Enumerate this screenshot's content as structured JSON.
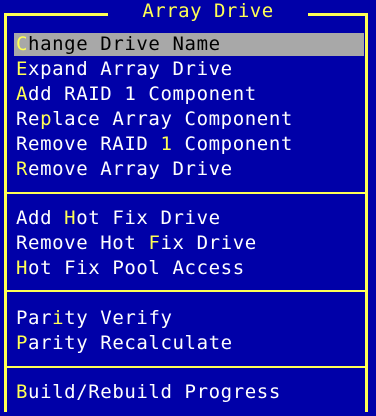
{
  "menu": {
    "title": "Array Drive",
    "groups": [
      {
        "items": [
          {
            "hotkey": "C",
            "rest": "hange Drive Name",
            "selected": true
          },
          {
            "hotkey": "E",
            "rest": "xpand Array Drive",
            "selected": false
          },
          {
            "hotkey": "A",
            "rest": "dd RAID 1 Component",
            "selected": false
          },
          {
            "prefix": "Re",
            "hotkey": "p",
            "rest": "lace Array Component",
            "selected": false
          },
          {
            "prefix": "Remove RAID ",
            "hotkey": "1",
            "rest": " Component",
            "selected": false
          },
          {
            "hotkey": "R",
            "rest": "emove Array Drive",
            "selected": false
          }
        ]
      },
      {
        "items": [
          {
            "prefix": "Add ",
            "hotkey": "H",
            "rest": "ot Fix Drive",
            "selected": false
          },
          {
            "prefix": "Remove Hot ",
            "hotkey": "F",
            "rest": "ix Drive",
            "selected": false
          },
          {
            "hotkey": "H",
            "rest": "ot Fix Pool Access",
            "selected": false
          }
        ]
      },
      {
        "items": [
          {
            "prefix": "Par",
            "hotkey": "i",
            "rest": "ty Verify",
            "selected": false
          },
          {
            "hotkey": "P",
            "rest": "arity Recalculate",
            "selected": false
          }
        ]
      },
      {
        "items": [
          {
            "hotkey": "B",
            "rest": "uild/Rebuild Progress",
            "selected": false
          }
        ]
      }
    ]
  },
  "colors": {
    "background": "#0000a8",
    "border": "#ffff54",
    "text": "#ffffff",
    "hotkey": "#ffff54",
    "selection_bg": "#a8a8a8",
    "selection_text": "#000000"
  }
}
